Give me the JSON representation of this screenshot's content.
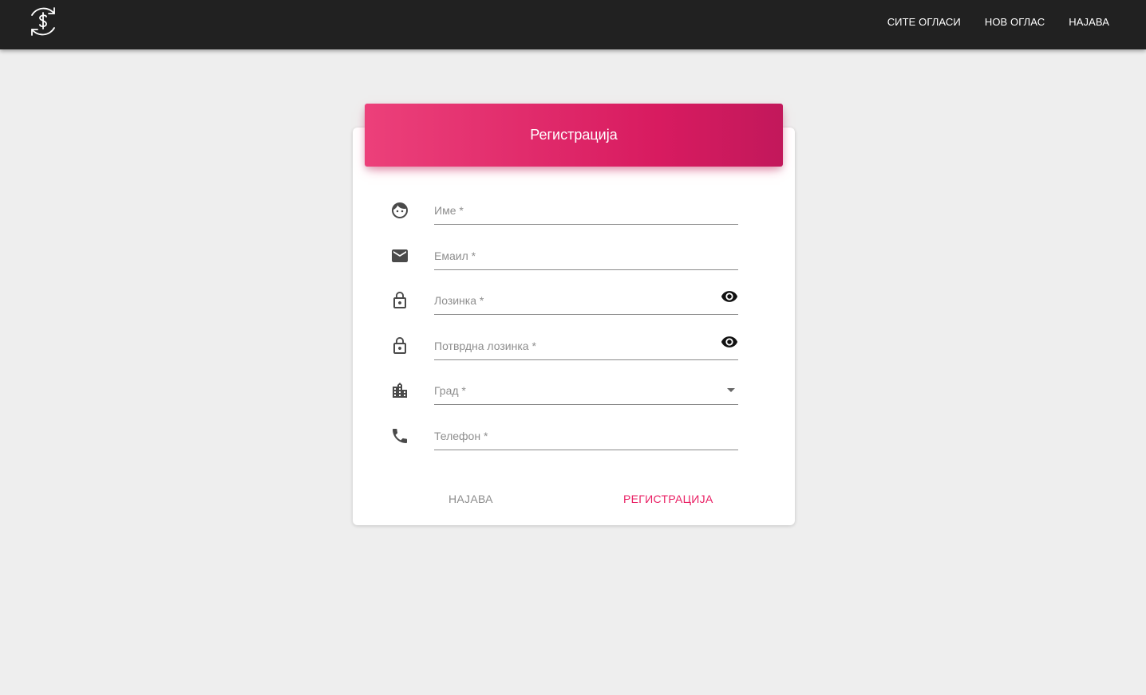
{
  "navbar": {
    "logo_icon": "dollar-refresh-icon",
    "links": [
      "СИТЕ ОГЛАСИ",
      "НОВ ОГЛАС",
      "НАЈАВА"
    ]
  },
  "card": {
    "title": "Регистрација",
    "accent_color": "#e91e63",
    "fields": [
      {
        "icon": "face-icon",
        "label": "Име *"
      },
      {
        "icon": "email-icon",
        "label": "Емаил *"
      },
      {
        "icon": "lock-icon",
        "label": "Лозинка *",
        "toggle_icon": "eye-icon"
      },
      {
        "icon": "lock-icon",
        "label": "Потврдна лозинка *",
        "toggle_icon": "eye-icon"
      },
      {
        "icon": "city-icon",
        "label": "Град *",
        "dropdown": true
      },
      {
        "icon": "phone-icon",
        "label": "Телефон *"
      }
    ],
    "buttons": {
      "login": "НАЈАВА",
      "register": "РЕГИСТРАЦИЈА"
    }
  }
}
